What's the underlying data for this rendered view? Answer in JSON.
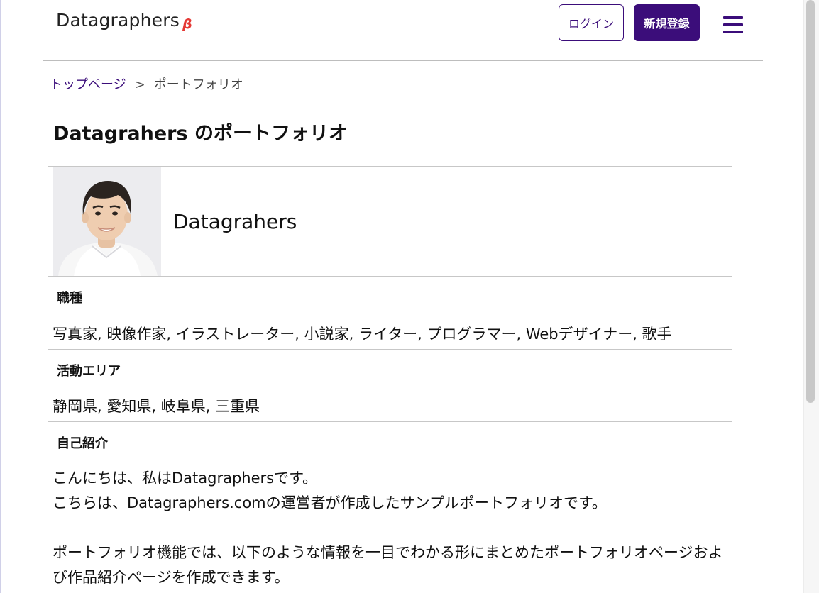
{
  "header": {
    "logo_text": "Datagraphers",
    "logo_beta": "β",
    "login_label": "ログイン",
    "signup_label": "新規登録",
    "menu_icon": "hamburger-menu-icon"
  },
  "breadcrumb": {
    "home": "トップページ",
    "separator": ">",
    "current": "ポートフォリオ"
  },
  "page": {
    "title": "Datagrahers のポートフォリオ"
  },
  "profile": {
    "name": "Datagrahers",
    "avatar": "profile-photo"
  },
  "sections": {
    "occupation_label": "職種",
    "occupation_value": "写真家, 映像作家, イラストレーター, 小説家, ライター, プログラマー, Webデザイナー, 歌手",
    "area_label": "活動エリア",
    "area_value": "静岡県, 愛知県, 岐阜県, 三重県",
    "bio_label": "自己紹介",
    "bio_line1": "こんにちは、私はDatagraphersです。",
    "bio_line2": "こちらは、Datagraphers.comの運営者が作成したサンプルポートフォリオです。",
    "bio_line3": "ポートフォリオ機能では、以下のような情報を一目でわかる形にまとめたポートフォリオページおよび作品紹介ページを作成できます。"
  },
  "colors": {
    "brand": "#3b0d7a",
    "beta": "#e53935",
    "rule": "#c7c7c7"
  }
}
